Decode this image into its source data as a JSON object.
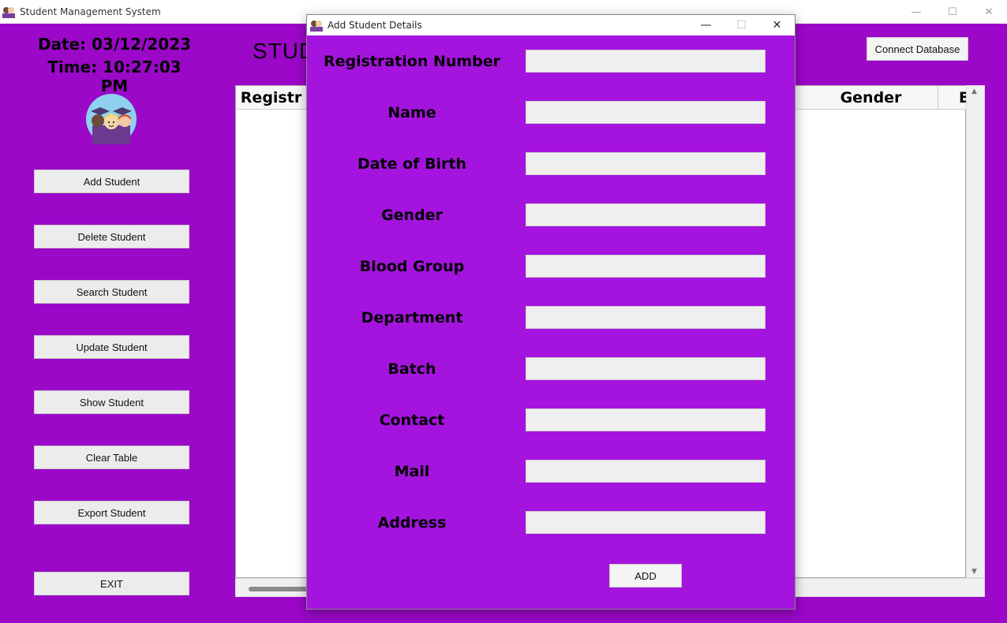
{
  "window": {
    "title": "Student Management System",
    "controls": {
      "minimize": "—",
      "maximize": "☐",
      "close": "✕"
    }
  },
  "clock": {
    "date": "Date: 03/12/2023",
    "time": "Time: 10:27:03 PM"
  },
  "sidebar": {
    "buttons": [
      {
        "label": "Add Student"
      },
      {
        "label": "Delete Student"
      },
      {
        "label": "Search Student"
      },
      {
        "label": "Update Student"
      },
      {
        "label": "Show Student"
      },
      {
        "label": "Clear Table"
      },
      {
        "label": "Export Student"
      },
      {
        "label": "EXIT"
      }
    ]
  },
  "header": {
    "connect_label": "Connect Database",
    "heading": "STUD"
  },
  "table": {
    "columns": [
      {
        "label": "Registr"
      },
      {
        "label": "Gender"
      },
      {
        "label": "B"
      }
    ]
  },
  "scroll": {
    "up": "▲",
    "down": "▼"
  },
  "dialog": {
    "title": "Add Student Details",
    "controls": {
      "minimize": "—",
      "maximize": "☐",
      "close": "✕"
    },
    "fields": [
      {
        "label": "Registration Number",
        "value": ""
      },
      {
        "label": "Name",
        "value": ""
      },
      {
        "label": "Date of Birth",
        "value": ""
      },
      {
        "label": "Gender",
        "value": ""
      },
      {
        "label": "Blood Group",
        "value": ""
      },
      {
        "label": "Department",
        "value": ""
      },
      {
        "label": "Batch",
        "value": ""
      },
      {
        "label": "Contact",
        "value": ""
      },
      {
        "label": "Mail",
        "value": ""
      },
      {
        "label": "Address",
        "value": ""
      }
    ],
    "add_label": "ADD"
  },
  "colors": {
    "background": "#9b08c8",
    "dialog_background": "#a414de"
  }
}
